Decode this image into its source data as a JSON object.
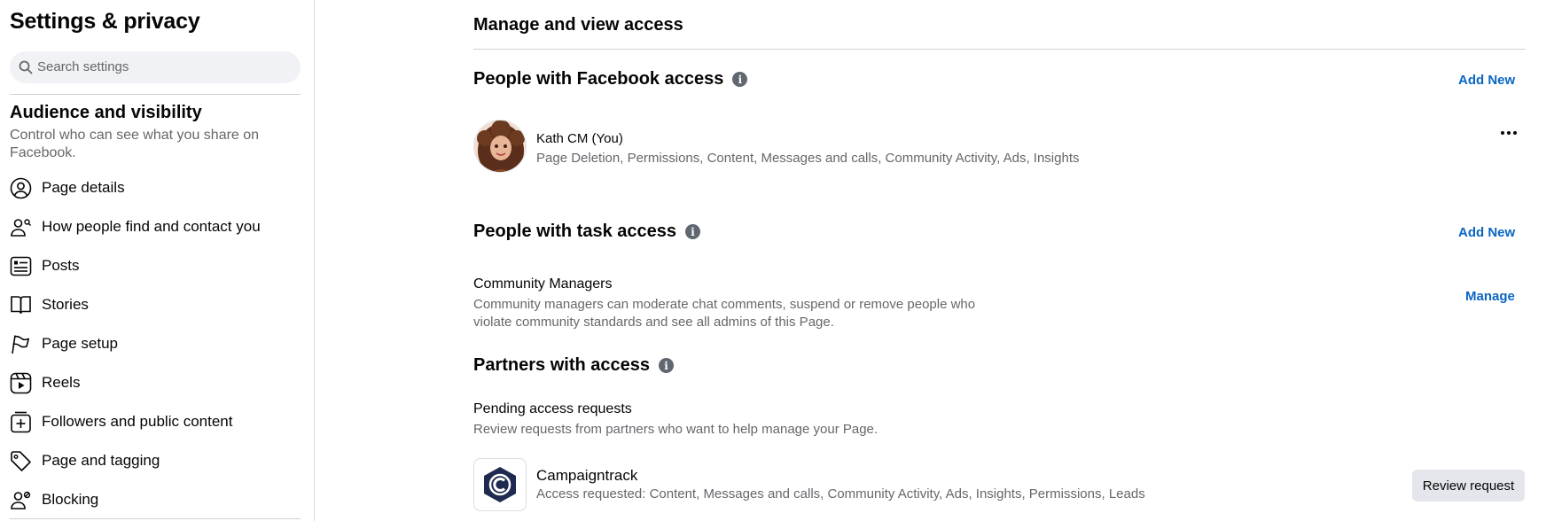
{
  "sidebar": {
    "title": "Settings & privacy",
    "search_placeholder": "Search settings",
    "section_title": "Audience and visibility",
    "section_desc": "Control who can see what you share on Facebook.",
    "items": [
      {
        "label": "Page details",
        "icon": "person-circle-icon"
      },
      {
        "label": "How people find and contact you",
        "icon": "person-search-icon"
      },
      {
        "label": "Posts",
        "icon": "posts-icon"
      },
      {
        "label": "Stories",
        "icon": "book-icon"
      },
      {
        "label": "Page setup",
        "icon": "flag-icon"
      },
      {
        "label": "Reels",
        "icon": "reels-icon"
      },
      {
        "label": "Followers and public content",
        "icon": "plus-square-icon"
      },
      {
        "label": "Page and tagging",
        "icon": "tag-icon"
      },
      {
        "label": "Blocking",
        "icon": "person-block-icon"
      }
    ]
  },
  "main": {
    "title": "Manage and view access",
    "facebook_access": {
      "title": "People with Facebook access",
      "add_label": "Add New",
      "person": {
        "name": "Kath CM (You)",
        "permissions": "Page Deletion, Permissions, Content, Messages and calls, Community Activity, Ads, Insights"
      }
    },
    "task_access": {
      "title": "People with task access",
      "add_label": "Add New",
      "group": {
        "title": "Community Managers",
        "desc": "Community managers can moderate chat comments, suspend or remove people who violate community standards and see all admins of this Page.",
        "manage_label": "Manage"
      }
    },
    "partners": {
      "title": "Partners with access",
      "pending_title": "Pending access requests",
      "pending_desc": "Review requests from partners who want to help manage your Page.",
      "partner": {
        "name": "Campaigntrack",
        "requested": "Access requested: Content, Messages and calls, Community Activity, Ads, Insights, Permissions, Leads",
        "button_label": "Review request"
      }
    }
  },
  "colors": {
    "link": "#0a66c2",
    "secondary_text": "#65676b",
    "search_bg": "#f0f2f5",
    "button_bg": "#e4e6eb",
    "logo_navy": "#1e2a4f"
  }
}
